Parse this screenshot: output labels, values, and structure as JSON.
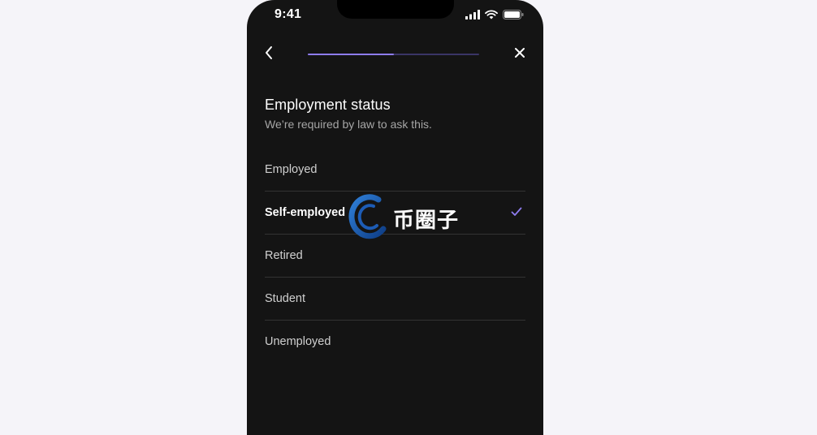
{
  "status_bar": {
    "time": "9:41",
    "icons": [
      "signal-icon",
      "wifi-icon",
      "battery-icon"
    ]
  },
  "nav": {
    "back_icon": "chevron-left-icon",
    "close_icon": "close-icon",
    "progress": 0.5
  },
  "header": {
    "title": "Employment status",
    "subtitle": "We’re required by law to ask this."
  },
  "options": [
    {
      "label": "Employed",
      "selected": false
    },
    {
      "label": "Self-employed",
      "selected": true
    },
    {
      "label": "Retired",
      "selected": false
    },
    {
      "label": "Student",
      "selected": false
    },
    {
      "label": "Unemployed",
      "selected": false
    }
  ],
  "watermark": {
    "text": "币圈子"
  },
  "colors": {
    "accent": "#8e7cf0",
    "background": "#141414",
    "page_background": "#f5f4f9"
  }
}
